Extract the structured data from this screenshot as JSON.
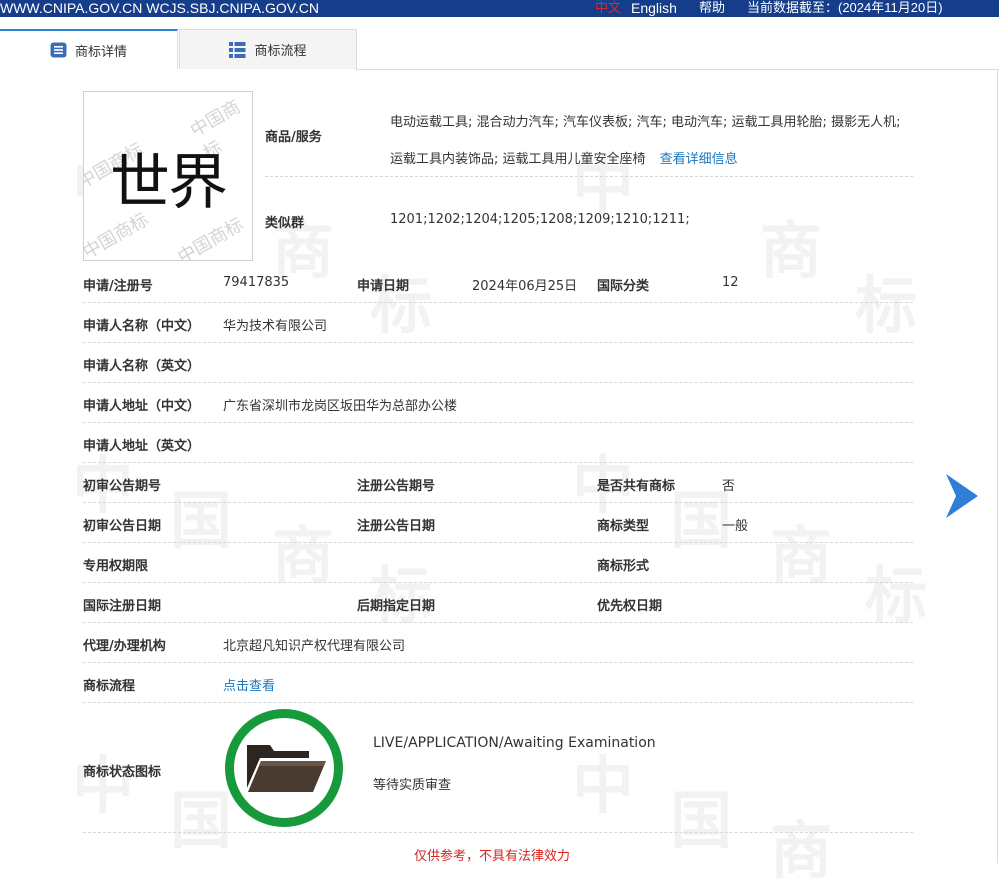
{
  "topbar": {
    "site": "WWW.CNIPA.GOV.CN WCJS.SBJ.CNIPA.GOV.CN",
    "lang_cn": "中文",
    "lang_en": "English",
    "help": "帮助",
    "data_date": "当前数据截至：(2024年11月20日)"
  },
  "tabs": [
    {
      "label": "商标详情",
      "icon": "document-list-icon"
    },
    {
      "label": "商标流程",
      "icon": "grid-list-icon"
    }
  ],
  "logo": {
    "mark_text": "世界",
    "watermark": "中国商标"
  },
  "goods": {
    "label": "商品/服务",
    "text": "电动运载工具; 混合动力汽车; 汽车仪表板; 汽车; 电动汽车; 运载工具用轮胎; 摄影无人机; 运载工具内装饰品; 运载工具用儿童安全座椅",
    "link": "查看详细信息"
  },
  "similar_group": {
    "label": "类似群",
    "value": "1201;1202;1204;1205;1208;1209;1210;1211;"
  },
  "reg_no": {
    "label": "申请/注册号",
    "value": "79417835"
  },
  "app_date": {
    "label": "申请日期",
    "value": "2024年06月25日"
  },
  "intl_class": {
    "label": "国际分类",
    "value": "12"
  },
  "applicant_cn": {
    "label": "申请人名称（中文）",
    "value": "华为技术有限公司"
  },
  "applicant_en": {
    "label": "申请人名称（英文）",
    "value": ""
  },
  "address_cn": {
    "label": "申请人地址（中文）",
    "value": "广东省深圳市龙岗区坂田华为总部办公楼"
  },
  "address_en": {
    "label": "申请人地址（英文）",
    "value": ""
  },
  "prelim_no": {
    "label": "初审公告期号",
    "value": ""
  },
  "reg_pub_no": {
    "label": "注册公告期号",
    "value": ""
  },
  "shared_mark": {
    "label": "是否共有商标",
    "value": "否"
  },
  "prelim_date": {
    "label": "初审公告日期",
    "value": ""
  },
  "reg_pub_date": {
    "label": "注册公告日期",
    "value": ""
  },
  "mark_type": {
    "label": "商标类型",
    "value": "一般"
  },
  "exclusive_period": {
    "label": "专用权期限",
    "value": ""
  },
  "mark_form": {
    "label": "商标形式",
    "value": ""
  },
  "intl_reg_date": {
    "label": "国际注册日期",
    "value": ""
  },
  "later_designation": {
    "label": "后期指定日期",
    "value": ""
  },
  "priority_date": {
    "label": "优先权日期",
    "value": ""
  },
  "agent": {
    "label": "代理/办理机构",
    "value": "北京超凡知识产权代理有限公司"
  },
  "process": {
    "label": "商标流程",
    "link": "点击查看"
  },
  "status": {
    "label": "商标状态图标",
    "en": "LIVE/APPLICATION/Awaiting Examination",
    "cn": "等待实质审查",
    "icon": "open-folder-icon"
  },
  "disclaimer": "仅供参考，不具有法律效力",
  "colors": {
    "topbar": "#153d8a",
    "link": "#1a78c2",
    "status_ring": "#169a3c",
    "disclaimer": "#d8231c",
    "arrow": "#2f7fd8"
  }
}
